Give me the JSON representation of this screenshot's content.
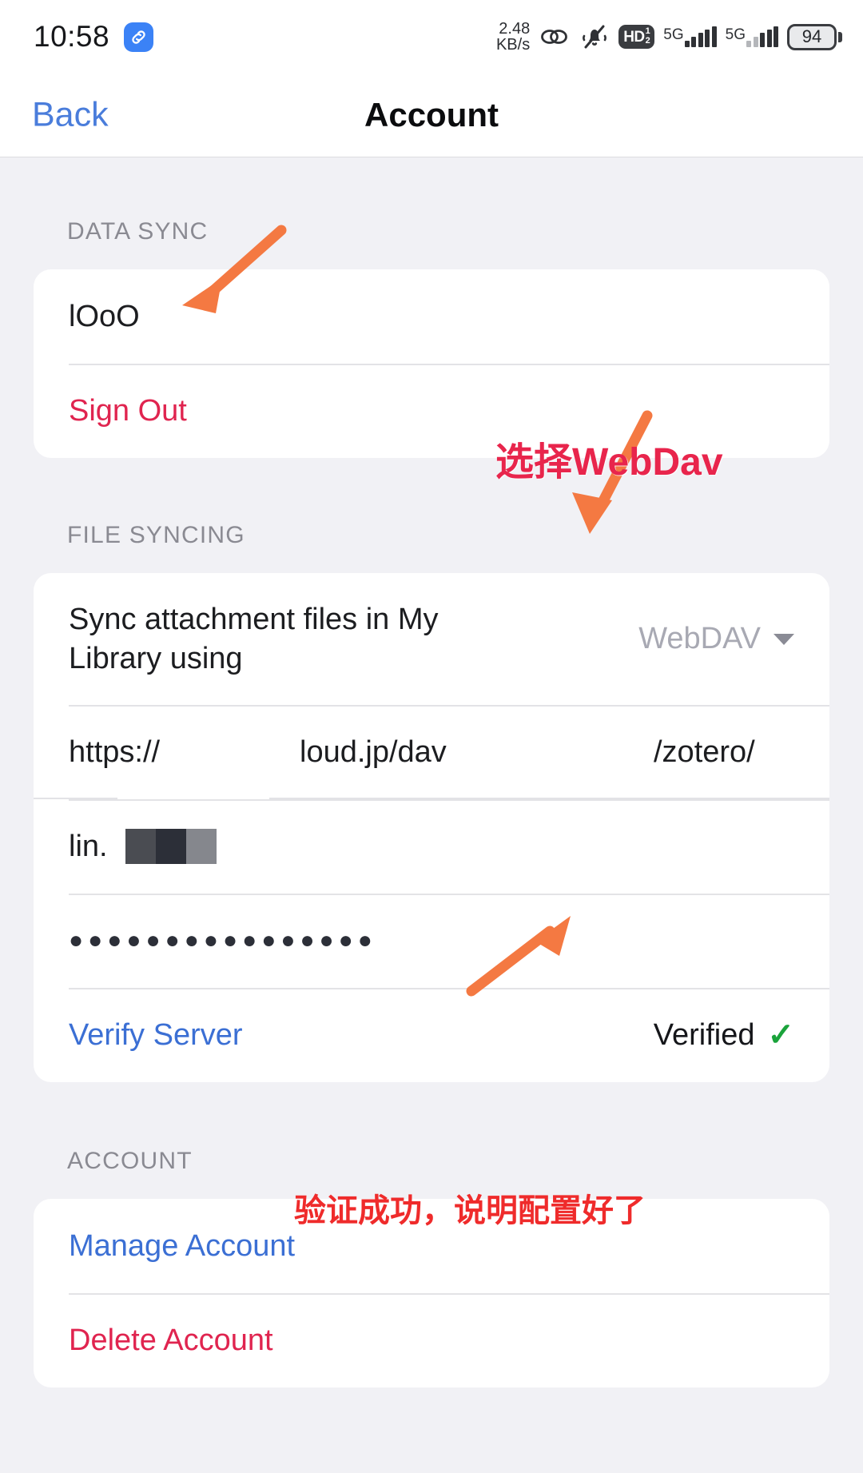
{
  "status_bar": {
    "time": "10:58",
    "app_badge_icon": "link-badge-icon",
    "net_speed_value": "2.48",
    "net_speed_unit": "KB/s",
    "icons": [
      "link-icon",
      "mute-bell-icon",
      "hd-voice-icon",
      "signal-5g-icon",
      "signal-5g-secondary-icon"
    ],
    "hd_label": "HD",
    "hd_sim_top": "1",
    "hd_sim_bottom": "2",
    "network_1": "5G",
    "network_2": "5G",
    "battery_level": "94"
  },
  "navbar": {
    "back_label": "Back",
    "title": "Account"
  },
  "sections": {
    "data_sync": {
      "header": "DATA SYNC",
      "username": "lOoO",
      "sign_out": "Sign Out"
    },
    "file_syncing": {
      "header": "FILE SYNCING",
      "sync_label": "Sync attachment files in My Library using",
      "sync_value": "WebDAV",
      "url_scheme": "https://",
      "url_host": "loud.jp/dav",
      "url_path": "/zotero/",
      "username_prefix": "lin.",
      "password_masked": "●●●●●●●●●●●●●●●●",
      "verify_label": "Verify Server",
      "verify_status": "Verified",
      "verify_check_icon": "check-icon"
    },
    "account": {
      "header": "ACCOUNT",
      "manage_account": "Manage Account",
      "delete_account": "Delete Account"
    }
  },
  "annotations": [
    {
      "text": "选择WebDav",
      "color": "#e8254c"
    },
    {
      "text": "验证成功，说明配置好了",
      "color": "#ef2b2b"
    }
  ],
  "colors": {
    "accent_blue": "#3b6fd4",
    "danger_red": "#e0244f",
    "annotation_orange": "#f47942",
    "page_bg": "#f1f1f5",
    "card_bg": "#ffffff"
  }
}
